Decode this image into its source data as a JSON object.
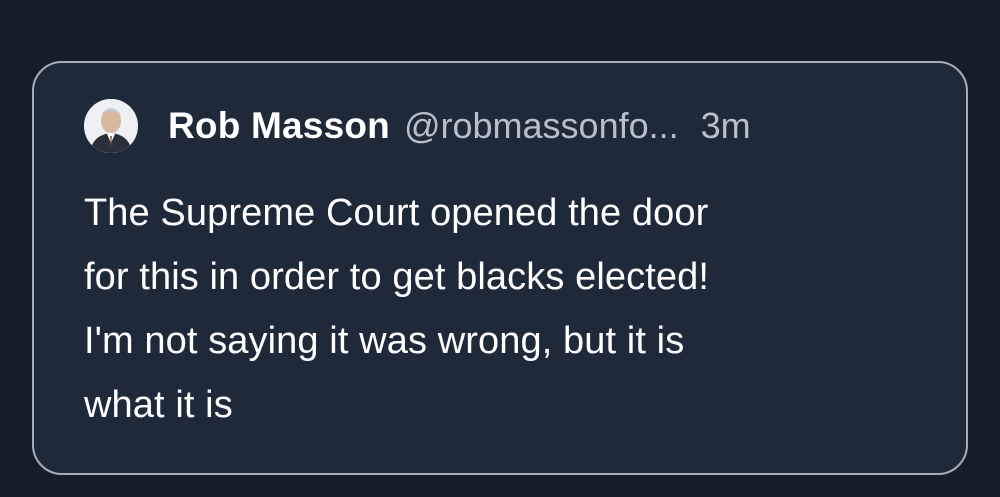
{
  "tweet": {
    "author_name": "Rob Masson",
    "author_handle": "@robmassonfo...",
    "timestamp": "3m",
    "text_lines": [
      "The Supreme Court opened the door",
      "for this in order to get blacks elected!",
      "I'm not saying it was wrong, but it is",
      "what it is"
    ]
  },
  "colors": {
    "background": "#151d28",
    "card": "#1e2a3a",
    "card_border": "#a4aeb9",
    "text_primary": "#ffffff",
    "text_secondary": "#b7c0ca"
  },
  "icons": {
    "avatar": "profile-photo"
  }
}
